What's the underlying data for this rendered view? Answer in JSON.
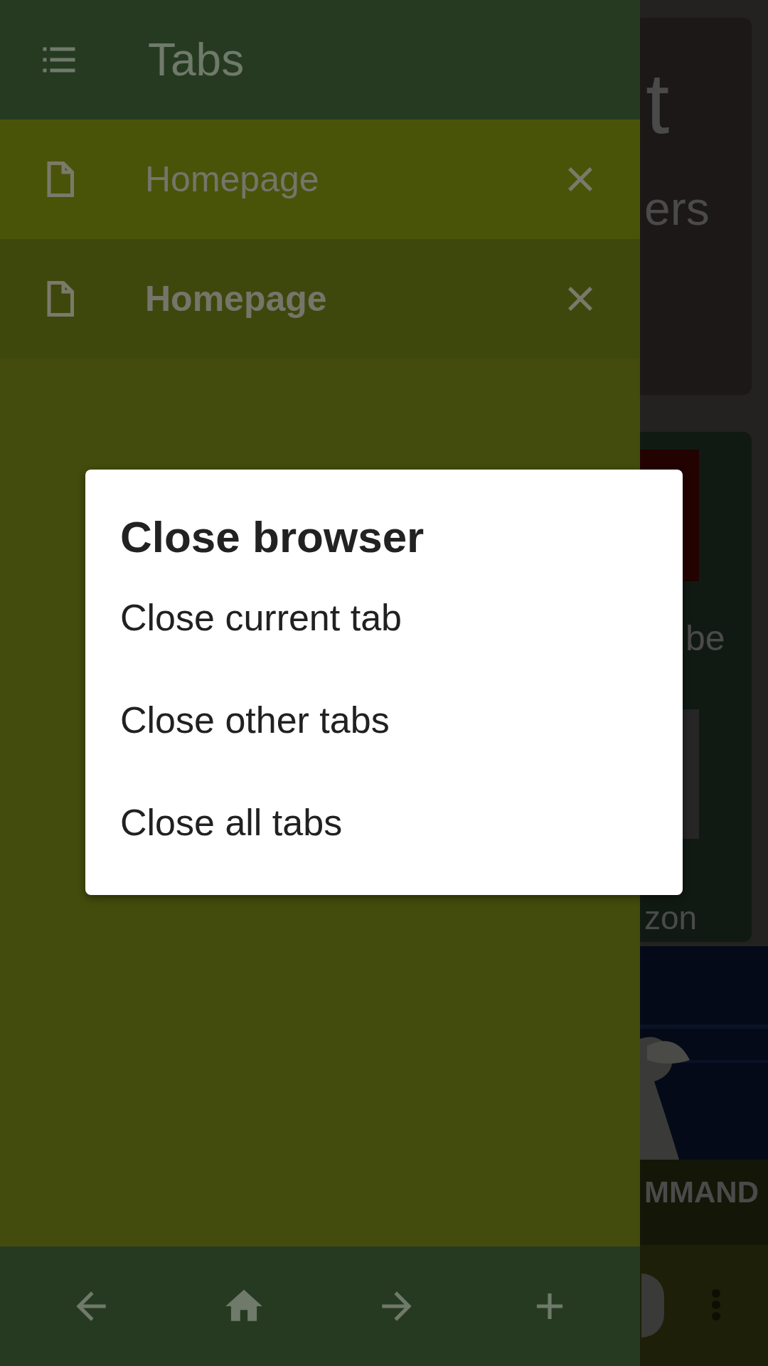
{
  "background_page": {
    "fragments": [
      "t",
      "ers",
      "be",
      "zon",
      "MMAND"
    ]
  },
  "drawer": {
    "title": "Tabs",
    "tabs": [
      {
        "title": "Homepage",
        "selected": false
      },
      {
        "title": "Homepage",
        "selected": true
      }
    ]
  },
  "dialog": {
    "title": "Close browser",
    "options": [
      "Close current tab",
      "Close other tabs",
      "Close all tabs"
    ]
  }
}
